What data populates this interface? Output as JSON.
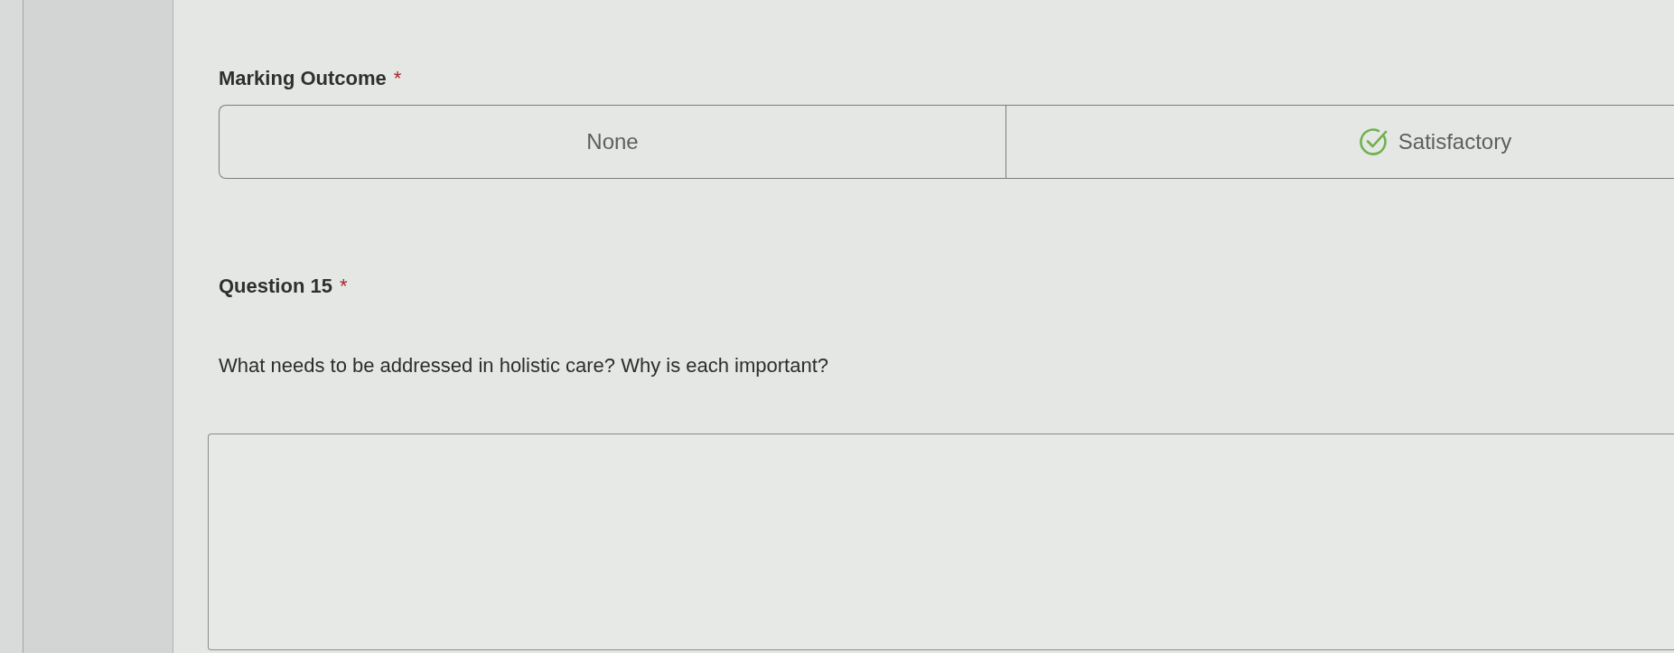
{
  "fields": [
    {
      "kind": "choice",
      "label": "Marking Outcome",
      "asterisk": "*",
      "options": [
        {
          "label": "None",
          "kind": "plain",
          "selected": false
        },
        {
          "label": "Satisfactory",
          "kind": "check",
          "selected": false
        }
      ]
    },
    {
      "kind": "question",
      "label": "Question 15",
      "asterisk": "*",
      "prompt": "What needs to be addressed in holistic care? Why is each important?"
    }
  ]
}
